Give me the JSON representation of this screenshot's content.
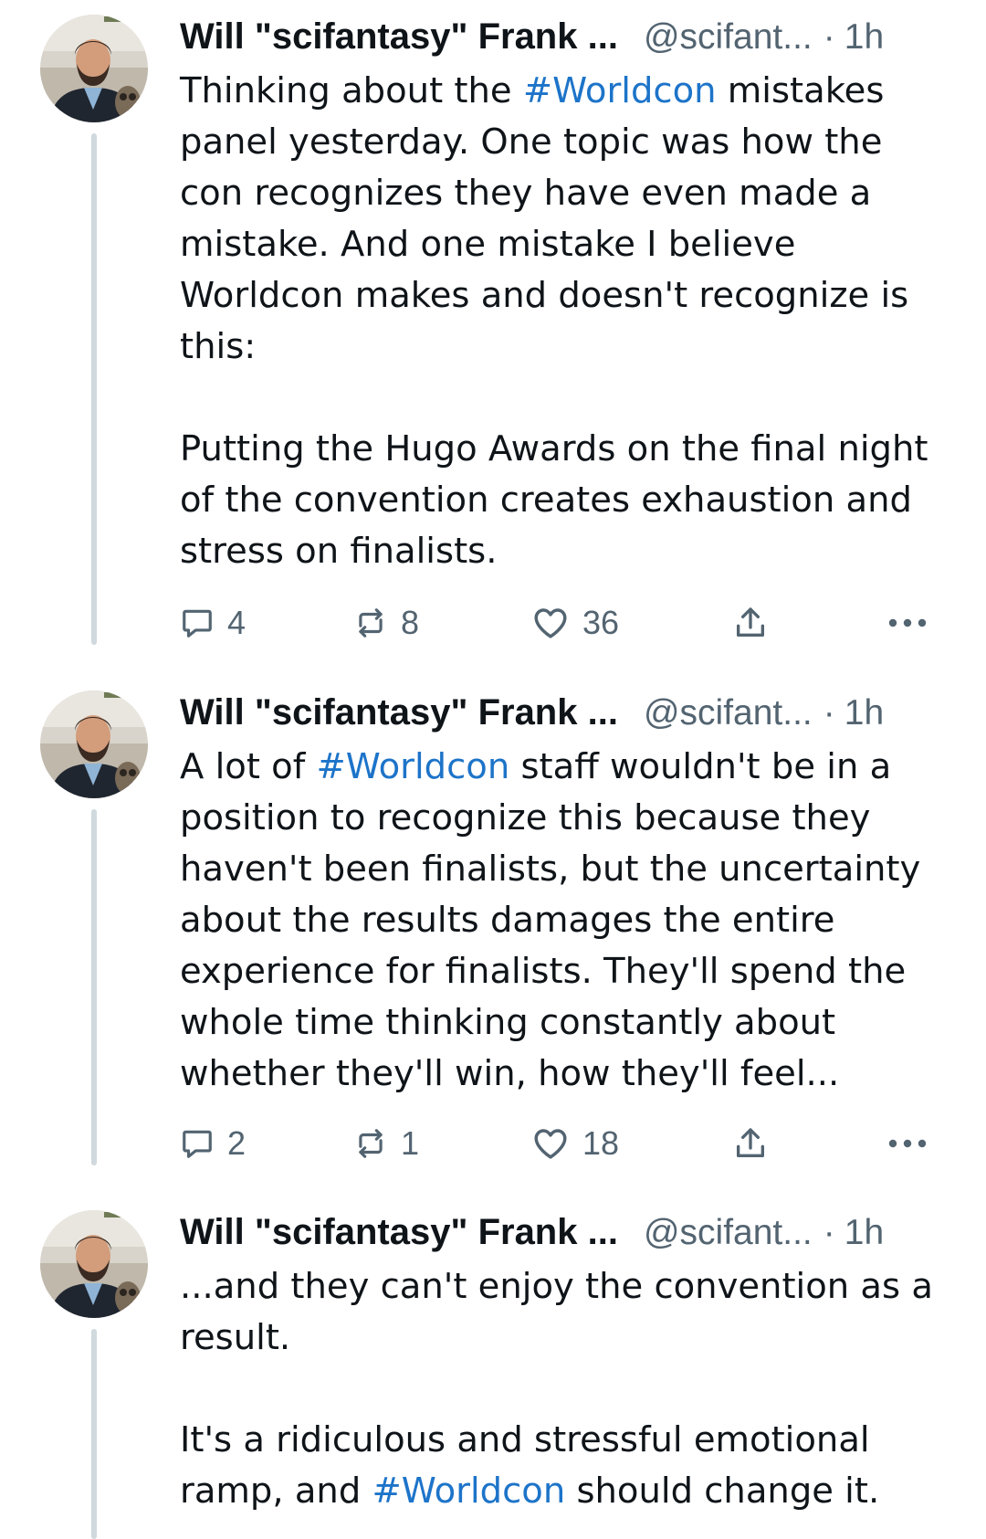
{
  "colors": {
    "text": "#0f1419",
    "secondary": "#536471",
    "hashtag": "#1d74c9",
    "thread_line": "#cfd9de"
  },
  "posts": [
    {
      "author": {
        "name": "Will \"scifantasy\" Frank ...",
        "handle": "@scifant...",
        "separator": "·",
        "time": "1h",
        "avatar_icon": "profile-photo"
      },
      "paragraphs": [
        [
          {
            "text": "Thinking about the "
          },
          {
            "text": "#Worldcon",
            "hashtag": true
          },
          {
            "text": " mistakes panel yesterday. One topic was how the con recognizes they have even made a mistake. And one mistake I believe Worldcon makes and doesn't recognize is this:"
          }
        ],
        [
          {
            "text": "Putting the Hugo Awards on the final night of the convention creates exhaustion and stress on finalists."
          }
        ]
      ],
      "stats": {
        "replies": "4",
        "reposts": "8",
        "likes": "36"
      }
    },
    {
      "author": {
        "name": "Will \"scifantasy\" Frank ...",
        "handle": "@scifant...",
        "separator": "·",
        "time": "1h",
        "avatar_icon": "profile-photo"
      },
      "paragraphs": [
        [
          {
            "text": "A lot of "
          },
          {
            "text": "#Worldcon",
            "hashtag": true
          },
          {
            "text": " staff wouldn't be in a position to recognize this because they haven't been finalists, but the uncertainty about the results damages the entire experience for finalists. They'll spend the whole time thinking constantly about whether they'll win, how they'll feel..."
          }
        ]
      ],
      "stats": {
        "replies": "2",
        "reposts": "1",
        "likes": "18"
      }
    },
    {
      "author": {
        "name": "Will \"scifantasy\" Frank ...",
        "handle": "@scifant...",
        "separator": "·",
        "time": "1h",
        "avatar_icon": "profile-photo"
      },
      "paragraphs": [
        [
          {
            "text": "...and they can't enjoy the convention as a result."
          }
        ],
        [
          {
            "text": "It's a ridiculous and stressful emotional ramp, and "
          },
          {
            "text": "#Worldcon",
            "hashtag": true
          },
          {
            "text": " should change it."
          }
        ]
      ]
    }
  ],
  "icons": {
    "reply": "speech-bubble-icon",
    "repost": "repost-arrows-icon",
    "like": "heart-icon",
    "share": "share-upload-icon",
    "more": "more-dots-icon"
  }
}
